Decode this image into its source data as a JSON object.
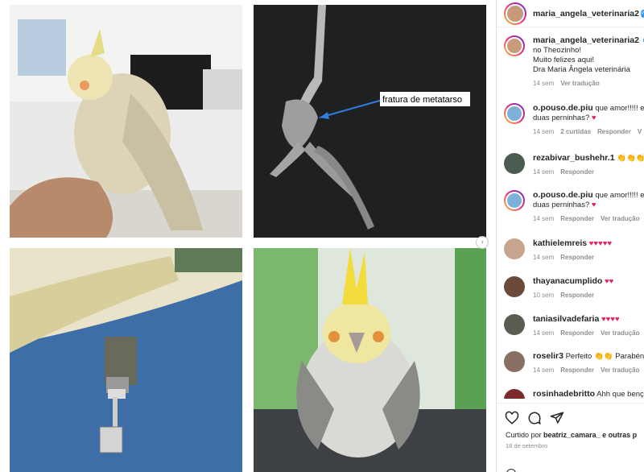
{
  "post": {
    "author": "maria_angela_veterinaria2",
    "caption_lines": [
      "maria_angela_veterinaria2",
      "no Theozinho!",
      "Muito felizes aqui!",
      "Dra Maria Ângela veterinária"
    ],
    "caption_lead": "C",
    "caption_time": "14 sem",
    "caption_translate": "Ver tradução",
    "xray_label": "fratura de metatarso"
  },
  "comments": [
    {
      "user": "o.pouso.de.piu",
      "text": "que amor!!!!! e",
      "text2": "duas perninhas?",
      "heart": "♥",
      "time": "14 sem",
      "likes": "2 curtidas",
      "reply": "Responder",
      "extra": "V"
    },
    {
      "user": "rezabivar_bushehr.1",
      "text": "👏👏👏",
      "time": "14 sem",
      "reply": "Responder"
    },
    {
      "user": "o.pouso.de.piu",
      "text": "que amor!!!!! e",
      "text2": "duas perninhas?",
      "heart": "♥",
      "time": "14 sem",
      "reply": "Responder",
      "translate": "Ver tradução"
    },
    {
      "user": "kathielemreis",
      "text": "♥♥♥♥♥",
      "time": "14 sem",
      "reply": "Responder"
    },
    {
      "user": "thayanacumplido",
      "text": "♥♥",
      "time": "10 sem",
      "reply": "Responder"
    },
    {
      "user": "taniasilvadefaria",
      "text": "♥♥♥♥",
      "time": "14 sem",
      "reply": "Responder",
      "translate": "Ver tradução"
    },
    {
      "user": "roselir3",
      "text": "Perfeito 👏👏 Parabén",
      "time": "14 sem",
      "reply": "Responder",
      "translate": "Ver tradução"
    },
    {
      "user": "rosinhadebritto",
      "text": "Ahh que bençã"
    }
  ],
  "footer": {
    "liked_by_prefix": "Curtido por",
    "liked_by_user": "beatriz_camara_",
    "liked_by_suffix": "e outras p",
    "date": "18 de setembro"
  },
  "icons": [
    "heart-icon",
    "comment-icon",
    "share-icon",
    "next-arrow-icon",
    "verified-icon"
  ],
  "colors": {
    "accent_red": "#e0245e",
    "verified_blue": "#3897f0",
    "muted": "#8e8e8e"
  }
}
